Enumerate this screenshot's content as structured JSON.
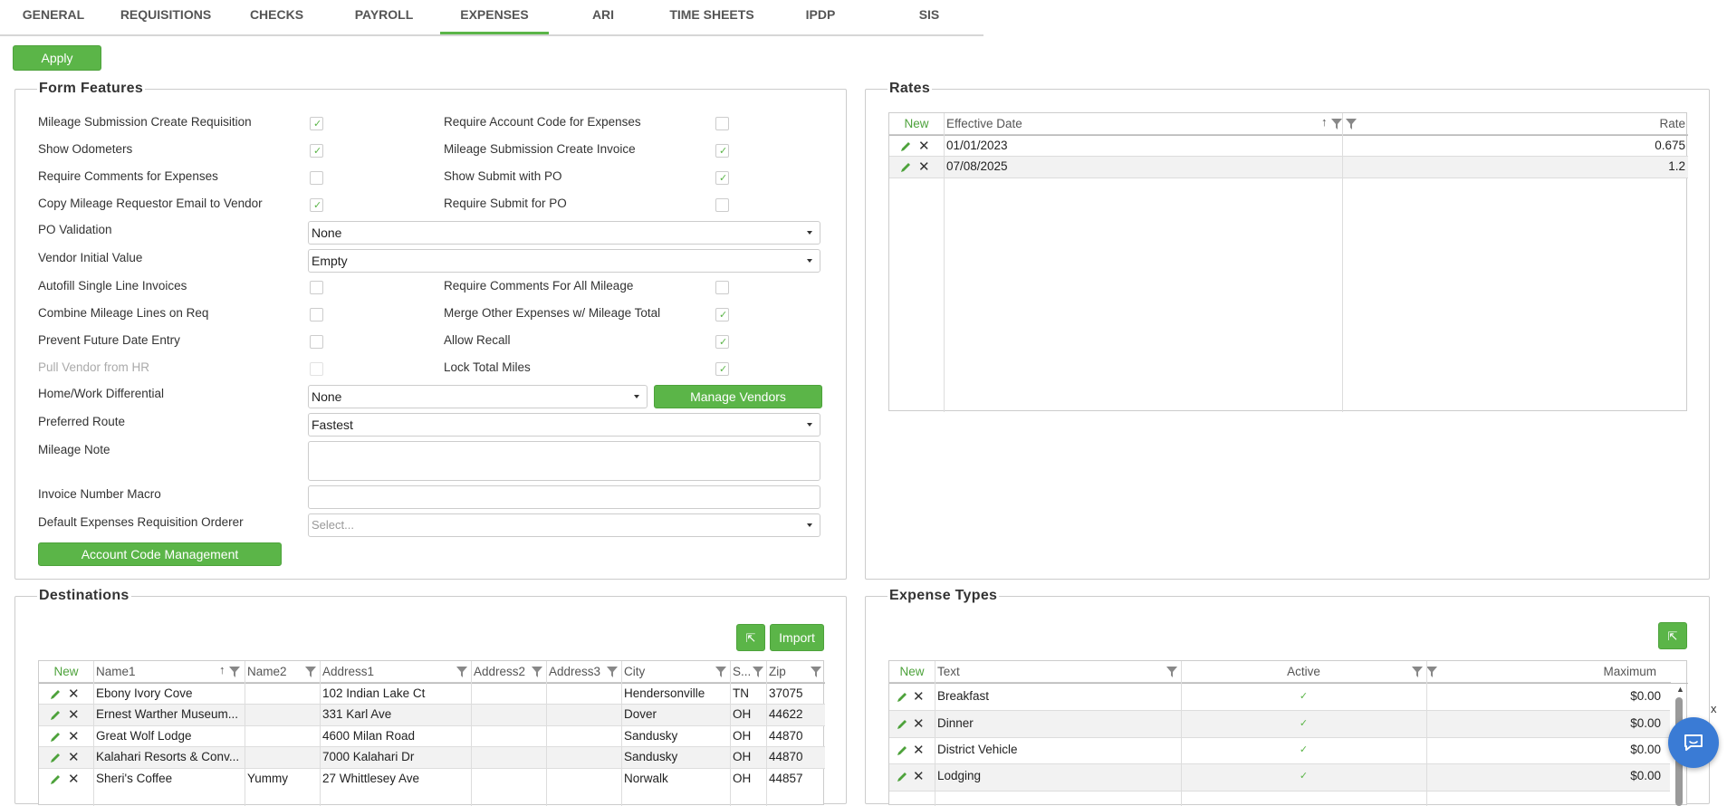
{
  "tabs": [
    "GENERAL",
    "REQUISITIONS",
    "CHECKS",
    "PAYROLL",
    "EXPENSES",
    "ARI",
    "TIME SHEETS",
    "IPDP",
    "SIS"
  ],
  "active_tab": "EXPENSES",
  "apply_label": "Apply",
  "form_features": {
    "title": "Form Features",
    "mileage_submission_create_requisition": {
      "label": "Mileage Submission Create Requisition",
      "checked": true
    },
    "require_account_code": {
      "label": "Require Account Code for Expenses",
      "checked": false
    },
    "show_odometers": {
      "label": "Show Odometers",
      "checked": true
    },
    "mileage_submission_create_invoice": {
      "label": "Mileage Submission Create Invoice",
      "checked": true
    },
    "require_comments_expenses": {
      "label": "Require Comments for Expenses",
      "checked": false
    },
    "show_submit_po": {
      "label": "Show Submit with PO",
      "checked": true
    },
    "copy_mileage_email": {
      "label": "Copy Mileage Requestor Email to Vendor",
      "checked": true
    },
    "require_submit_po": {
      "label": "Require Submit for PO",
      "checked": false
    },
    "po_validation": {
      "label": "PO Validation",
      "value": "None"
    },
    "vendor_initial_value": {
      "label": "Vendor Initial Value",
      "value": "Empty"
    },
    "autofill_single_line": {
      "label": "Autofill Single Line Invoices",
      "checked": false
    },
    "require_comments_all_mileage": {
      "label": "Require Comments For All Mileage",
      "checked": false
    },
    "combine_mileage_lines": {
      "label": "Combine Mileage Lines on Req",
      "checked": false
    },
    "merge_other_expenses": {
      "label": "Merge Other Expenses w/ Mileage Total",
      "checked": true
    },
    "prevent_future_date": {
      "label": "Prevent Future Date Entry",
      "checked": false
    },
    "allow_recall": {
      "label": "Allow Recall",
      "checked": true
    },
    "pull_vendor_hr": {
      "label": "Pull Vendor from HR",
      "checked": false
    },
    "lock_total_miles": {
      "label": "Lock Total Miles",
      "checked": true
    },
    "home_work_differential": {
      "label": "Home/Work Differential",
      "value": "None"
    },
    "manage_vendors_label": "Manage Vendors",
    "preferred_route": {
      "label": "Preferred Route",
      "value": "Fastest"
    },
    "mileage_note": {
      "label": "Mileage Note",
      "value": ""
    },
    "invoice_number_macro": {
      "label": "Invoice Number Macro",
      "value": ""
    },
    "default_orderer": {
      "label": "Default Expenses Requisition Orderer",
      "placeholder": "Select..."
    },
    "account_code_management_label": "Account Code Management"
  },
  "rates": {
    "title": "Rates",
    "new_label": "New",
    "headers": [
      "Effective Date",
      "Rate"
    ],
    "rows": [
      {
        "date": "01/01/2023",
        "rate": "0.675"
      },
      {
        "date": "07/08/2025",
        "rate": "1.2"
      }
    ]
  },
  "destinations": {
    "title": "Destinations",
    "import_label": "Import",
    "new_label": "New",
    "headers": [
      "Name1",
      "Name2",
      "Address1",
      "Address2",
      "Address3",
      "City",
      "S...",
      "Zip"
    ],
    "rows": [
      [
        "Ebony Ivory Cove",
        "",
        "102 Indian Lake Ct",
        "",
        "",
        "Hendersonville",
        "TN",
        "37075"
      ],
      [
        "Ernest Warther Museum...",
        "",
        "331 Karl Ave",
        "",
        "",
        "Dover",
        "OH",
        "44622"
      ],
      [
        "Great Wolf Lodge",
        "",
        "4600 Milan Road",
        "",
        "",
        "Sandusky",
        "OH",
        "44870"
      ],
      [
        "Kalahari Resorts & Conv...",
        "",
        "7000 Kalahari Dr",
        "",
        "",
        "Sandusky",
        "OH",
        "44870"
      ],
      [
        "Sheri's Coffee",
        "Yummy",
        "27 Whittlesey Ave",
        "",
        "",
        "Norwalk",
        "OH",
        "44857"
      ]
    ]
  },
  "expense_types": {
    "title": "Expense Types",
    "new_label": "New",
    "headers": [
      "Text",
      "Active",
      "Maximum"
    ],
    "rows": [
      {
        "text": "Breakfast",
        "active": true,
        "max": "$0.00"
      },
      {
        "text": "Dinner",
        "active": true,
        "max": "$0.00"
      },
      {
        "text": "District Vehicle",
        "active": true,
        "max": "$0.00"
      },
      {
        "text": "Lodging",
        "active": true,
        "max": "$0.00"
      }
    ]
  },
  "chat_close": "x",
  "colors": {
    "accent": "#5bb548",
    "chat": "#3a7bd5"
  }
}
